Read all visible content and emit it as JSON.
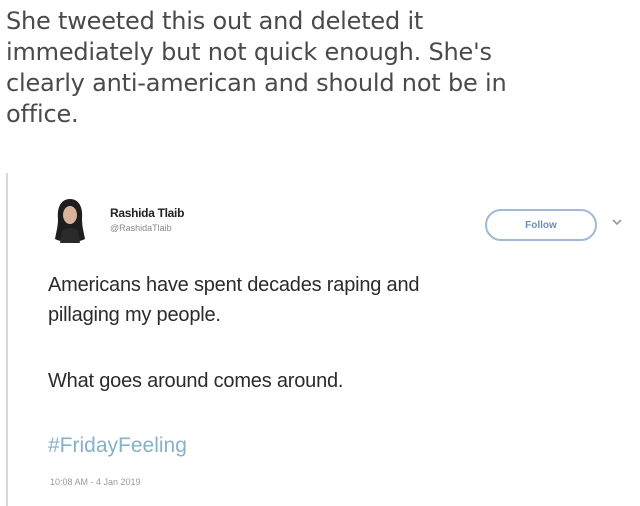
{
  "caption": {
    "lines": [
      "She tweeted this out and deleted it",
      "immediately but not quick enough. She's",
      "clearly anti-american and should not be in",
      "office."
    ]
  },
  "tweet": {
    "author_name": "Rashida Tlaib",
    "author_handle": "@RashidaTlaib",
    "follow_label": "Follow",
    "text_lines": [
      "Americans have spent decades raping and",
      "pillaging my people.",
      "What goes around comes around."
    ],
    "hashtag": "#FridayFeeling",
    "timestamp": "10:08 AM - 4 Jan 2019",
    "colors": {
      "hashtag": "#86b1c9",
      "follow_border": "#9fbad6"
    },
    "icons": {
      "avatar": "avatar",
      "menu": "chevron-down-icon"
    }
  }
}
